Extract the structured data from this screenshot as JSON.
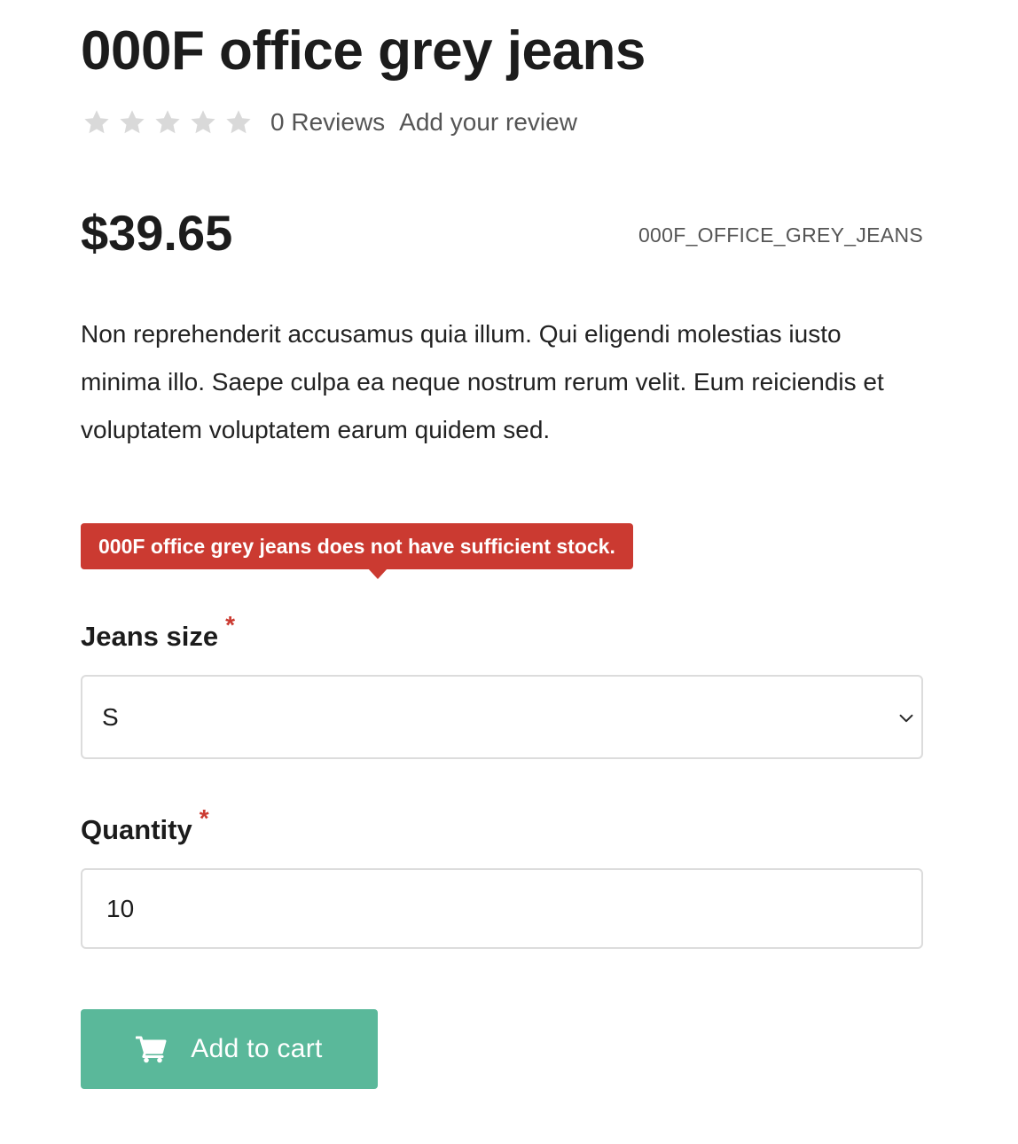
{
  "product": {
    "title": "000F office grey jeans",
    "rating": 0,
    "rating_max": 5,
    "reviews_label": "0 Reviews",
    "add_review_label": "Add your review",
    "price": "$39.65",
    "sku": "000F_OFFICE_GREY_JEANS",
    "description": "Non reprehenderit accusamus quia illum. Qui eligendi molestias iusto minima illo. Saepe culpa ea neque nostrum rerum velit. Eum reiciendis et voluptatem voluptatem earum quidem sed."
  },
  "alert": {
    "message": "000F office grey jeans does not have sufficient stock.",
    "color": "#cb3a31"
  },
  "form": {
    "size": {
      "label": "Jeans size",
      "required_mark": "*",
      "selected": "S"
    },
    "quantity": {
      "label": "Quantity",
      "required_mark": "*",
      "value": "10"
    },
    "submit": {
      "label": "Add to cart",
      "icon": "cart-icon",
      "color": "#5ab89a"
    }
  },
  "icons": {
    "star": "star-icon",
    "chevron": "chevron-down-icon"
  }
}
